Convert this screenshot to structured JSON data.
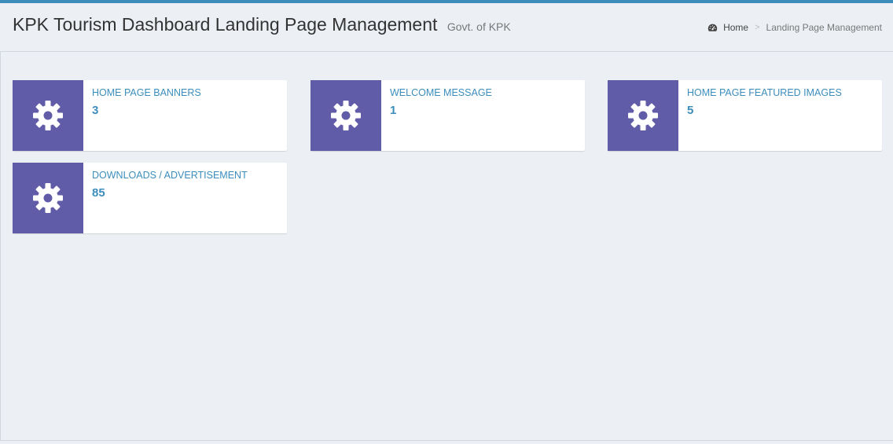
{
  "header": {
    "title": "KPK Tourism Dashboard Landing Page Management",
    "subtitle": "Govt. of KPK"
  },
  "breadcrumb": {
    "home_icon": "dashboard-gauge-icon",
    "home": "Home",
    "separator": ">",
    "current": "Landing Page Management"
  },
  "cards": [
    {
      "label": "HOME PAGE BANNERS",
      "count": "3",
      "icon": "gear-icon"
    },
    {
      "label": "WELCOME MESSAGE",
      "count": "1",
      "icon": "gear-icon"
    },
    {
      "label": "HOME PAGE FEATURED IMAGES",
      "count": "5",
      "icon": "gear-icon"
    },
    {
      "label": "DOWNLOADS / ADVERTISEMENT",
      "count": "85",
      "icon": "gear-icon"
    }
  ],
  "colors": {
    "accent": "#3c8dbc",
    "icon_bg": "#605ca8",
    "page_bg": "#ecf0f5"
  }
}
